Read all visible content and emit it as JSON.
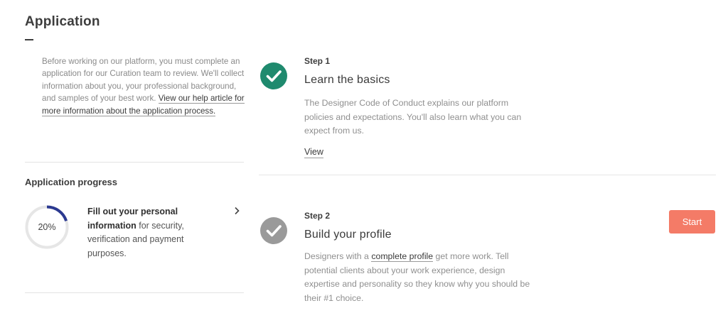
{
  "header": {
    "title": "Application"
  },
  "sidebar": {
    "intro_text": "Before working on our platform, you must complete an application for our Curation team to review. We'll collect information about you, your professional background, and samples of your best work.",
    "help_link": "View our help article for more information about the application process.",
    "progress": {
      "heading": "Application progress",
      "percent_label": "20%",
      "percent_value": 0.2,
      "ring_color": "#2b3990",
      "task_bold": "Fill out your personal information",
      "task_rest": " for security, verification and payment purposes.",
      "chevron_icon": "chevron-right-icon"
    }
  },
  "steps": [
    {
      "label": "Step 1",
      "title": "Learn the basics",
      "description": "The Designer Code of Conduct explains our platform policies and expectations. You'll also learn what you can expect from us.",
      "link": "View",
      "icon": "check-circle-icon",
      "status": "complete",
      "icon_color": "#1f8a6e"
    },
    {
      "label": "Step 2",
      "title": "Build your profile",
      "description_pre": "Designers with a ",
      "description_link": "complete profile",
      "description_post": " get more work. Tell potential clients about your work experience, design expertise and personality so they know why you should be their #1 choice.",
      "button": "Start",
      "icon": "check-circle-icon",
      "status": "incomplete",
      "icon_color": "#9a9a9a",
      "button_color": "#f47b67"
    }
  ]
}
